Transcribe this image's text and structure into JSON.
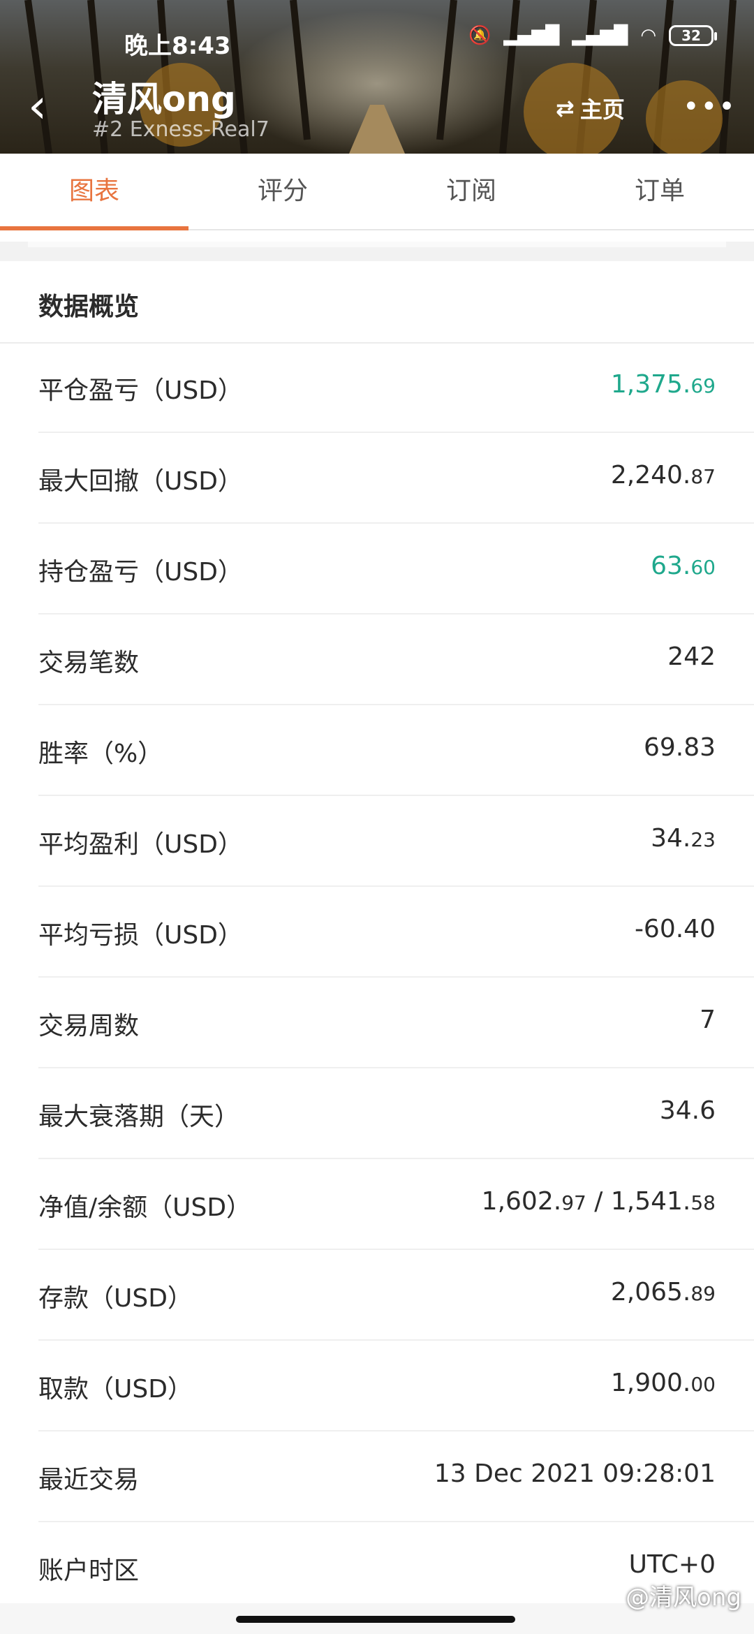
{
  "status_bar": {
    "time": "晚上8:43",
    "battery": "32"
  },
  "header": {
    "account_name": "清风ong",
    "rank_server": "#2  Exness-Real7",
    "home_label": "主页"
  },
  "tabs": [
    {
      "label": "图表",
      "active": true
    },
    {
      "label": "评分",
      "active": false
    },
    {
      "label": "订阅",
      "active": false
    },
    {
      "label": "订单",
      "active": false
    }
  ],
  "section_title": "数据概览",
  "stats": [
    {
      "label": "平仓盈亏（USD）",
      "int": "1,375.",
      "dec": "69",
      "green": true
    },
    {
      "label": "最大回撤（USD）",
      "int": "2,240.",
      "dec": "87"
    },
    {
      "label": "持仓盈亏（USD）",
      "int": "63.",
      "dec": "60",
      "green": true
    },
    {
      "label": "交易笔数",
      "int": "242",
      "dec": ""
    },
    {
      "label": "胜率（%）",
      "int": "69.83",
      "dec": ""
    },
    {
      "label": "平均盈利（USD）",
      "int": "34.",
      "dec": "23"
    },
    {
      "label": "平均亏损（USD）",
      "int": "-60.40",
      "dec": ""
    },
    {
      "label": "交易周数",
      "int": "7",
      "dec": ""
    },
    {
      "label": "最大衰落期（天）",
      "int": "34.6",
      "dec": ""
    },
    {
      "label": "净值/余额（USD）",
      "int": "1,602.",
      "dec": "97",
      "int2": " / 1,541.",
      "dec2": "58"
    },
    {
      "label": "存款（USD）",
      "int": "2,065.",
      "dec": "89"
    },
    {
      "label": "取款（USD）",
      "int": "1,900.",
      "dec": "00"
    },
    {
      "label": "最近交易",
      "int": "13 Dec 2021 09:28:01",
      "dec": ""
    },
    {
      "label": "账户时区",
      "int": "UTC+0",
      "dec": ""
    }
  ],
  "watermark": "@清风ong"
}
